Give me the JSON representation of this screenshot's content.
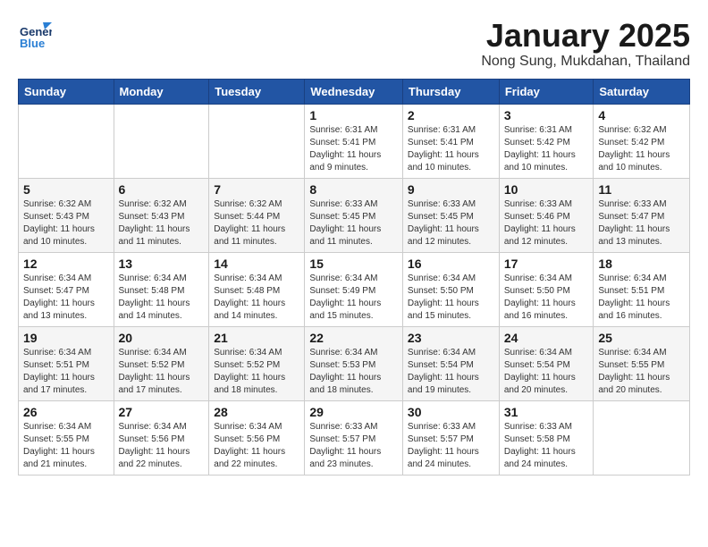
{
  "logo": {
    "line1": "General",
    "line2": "Blue"
  },
  "title": "January 2025",
  "subtitle": "Nong Sung, Mukdahan, Thailand",
  "headers": [
    "Sunday",
    "Monday",
    "Tuesday",
    "Wednesday",
    "Thursday",
    "Friday",
    "Saturday"
  ],
  "weeks": [
    [
      {
        "day": "",
        "info": ""
      },
      {
        "day": "",
        "info": ""
      },
      {
        "day": "",
        "info": ""
      },
      {
        "day": "1",
        "info": "Sunrise: 6:31 AM\nSunset: 5:41 PM\nDaylight: 11 hours\nand 9 minutes."
      },
      {
        "day": "2",
        "info": "Sunrise: 6:31 AM\nSunset: 5:41 PM\nDaylight: 11 hours\nand 10 minutes."
      },
      {
        "day": "3",
        "info": "Sunrise: 6:31 AM\nSunset: 5:42 PM\nDaylight: 11 hours\nand 10 minutes."
      },
      {
        "day": "4",
        "info": "Sunrise: 6:32 AM\nSunset: 5:42 PM\nDaylight: 11 hours\nand 10 minutes."
      }
    ],
    [
      {
        "day": "5",
        "info": "Sunrise: 6:32 AM\nSunset: 5:43 PM\nDaylight: 11 hours\nand 10 minutes."
      },
      {
        "day": "6",
        "info": "Sunrise: 6:32 AM\nSunset: 5:43 PM\nDaylight: 11 hours\nand 11 minutes."
      },
      {
        "day": "7",
        "info": "Sunrise: 6:32 AM\nSunset: 5:44 PM\nDaylight: 11 hours\nand 11 minutes."
      },
      {
        "day": "8",
        "info": "Sunrise: 6:33 AM\nSunset: 5:45 PM\nDaylight: 11 hours\nand 11 minutes."
      },
      {
        "day": "9",
        "info": "Sunrise: 6:33 AM\nSunset: 5:45 PM\nDaylight: 11 hours\nand 12 minutes."
      },
      {
        "day": "10",
        "info": "Sunrise: 6:33 AM\nSunset: 5:46 PM\nDaylight: 11 hours\nand 12 minutes."
      },
      {
        "day": "11",
        "info": "Sunrise: 6:33 AM\nSunset: 5:47 PM\nDaylight: 11 hours\nand 13 minutes."
      }
    ],
    [
      {
        "day": "12",
        "info": "Sunrise: 6:34 AM\nSunset: 5:47 PM\nDaylight: 11 hours\nand 13 minutes."
      },
      {
        "day": "13",
        "info": "Sunrise: 6:34 AM\nSunset: 5:48 PM\nDaylight: 11 hours\nand 14 minutes."
      },
      {
        "day": "14",
        "info": "Sunrise: 6:34 AM\nSunset: 5:48 PM\nDaylight: 11 hours\nand 14 minutes."
      },
      {
        "day": "15",
        "info": "Sunrise: 6:34 AM\nSunset: 5:49 PM\nDaylight: 11 hours\nand 15 minutes."
      },
      {
        "day": "16",
        "info": "Sunrise: 6:34 AM\nSunset: 5:50 PM\nDaylight: 11 hours\nand 15 minutes."
      },
      {
        "day": "17",
        "info": "Sunrise: 6:34 AM\nSunset: 5:50 PM\nDaylight: 11 hours\nand 16 minutes."
      },
      {
        "day": "18",
        "info": "Sunrise: 6:34 AM\nSunset: 5:51 PM\nDaylight: 11 hours\nand 16 minutes."
      }
    ],
    [
      {
        "day": "19",
        "info": "Sunrise: 6:34 AM\nSunset: 5:51 PM\nDaylight: 11 hours\nand 17 minutes."
      },
      {
        "day": "20",
        "info": "Sunrise: 6:34 AM\nSunset: 5:52 PM\nDaylight: 11 hours\nand 17 minutes."
      },
      {
        "day": "21",
        "info": "Sunrise: 6:34 AM\nSunset: 5:52 PM\nDaylight: 11 hours\nand 18 minutes."
      },
      {
        "day": "22",
        "info": "Sunrise: 6:34 AM\nSunset: 5:53 PM\nDaylight: 11 hours\nand 18 minutes."
      },
      {
        "day": "23",
        "info": "Sunrise: 6:34 AM\nSunset: 5:54 PM\nDaylight: 11 hours\nand 19 minutes."
      },
      {
        "day": "24",
        "info": "Sunrise: 6:34 AM\nSunset: 5:54 PM\nDaylight: 11 hours\nand 20 minutes."
      },
      {
        "day": "25",
        "info": "Sunrise: 6:34 AM\nSunset: 5:55 PM\nDaylight: 11 hours\nand 20 minutes."
      }
    ],
    [
      {
        "day": "26",
        "info": "Sunrise: 6:34 AM\nSunset: 5:55 PM\nDaylight: 11 hours\nand 21 minutes."
      },
      {
        "day": "27",
        "info": "Sunrise: 6:34 AM\nSunset: 5:56 PM\nDaylight: 11 hours\nand 22 minutes."
      },
      {
        "day": "28",
        "info": "Sunrise: 6:34 AM\nSunset: 5:56 PM\nDaylight: 11 hours\nand 22 minutes."
      },
      {
        "day": "29",
        "info": "Sunrise: 6:33 AM\nSunset: 5:57 PM\nDaylight: 11 hours\nand 23 minutes."
      },
      {
        "day": "30",
        "info": "Sunrise: 6:33 AM\nSunset: 5:57 PM\nDaylight: 11 hours\nand 24 minutes."
      },
      {
        "day": "31",
        "info": "Sunrise: 6:33 AM\nSunset: 5:58 PM\nDaylight: 11 hours\nand 24 minutes."
      },
      {
        "day": "",
        "info": ""
      }
    ]
  ]
}
